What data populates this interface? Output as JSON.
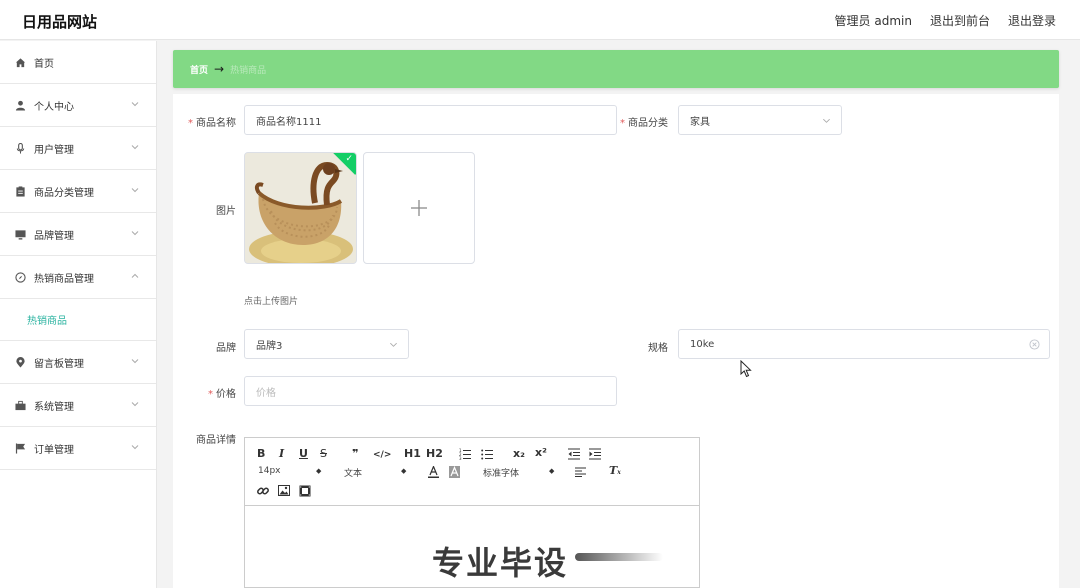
{
  "header": {
    "site_title": "日用品网站",
    "admin_label": "管理员 admin",
    "exit_front_label": "退出到前台",
    "logout_label": "退出登录"
  },
  "sidebar": {
    "items": [
      {
        "label": "首页",
        "icon": "home-icon"
      },
      {
        "label": "个人中心",
        "icon": "user-icon"
      },
      {
        "label": "用户管理",
        "icon": "microphone-icon"
      },
      {
        "label": "商品分类管理",
        "icon": "clipboard-icon"
      },
      {
        "label": "品牌管理",
        "icon": "monitor-icon"
      },
      {
        "label": "热销商品管理",
        "icon": "compass-icon"
      },
      {
        "label": "热销商品",
        "icon": ""
      },
      {
        "label": "留言板管理",
        "icon": "location-pin-icon"
      },
      {
        "label": "系统管理",
        "icon": "suitcase-icon"
      },
      {
        "label": "订单管理",
        "icon": "flag-icon"
      }
    ]
  },
  "breadcrumb": {
    "home": "首页",
    "arrow": "→",
    "current": "热销商品"
  },
  "form": {
    "name_label": "商品名称",
    "name_value": "商品名称1111",
    "category_label": "商品分类",
    "category_value": "家具",
    "image_label": "图片",
    "upload_hint": "点击上传图片",
    "brand_label": "品牌",
    "brand_value": "品牌3",
    "spec_label": "规格",
    "spec_value": "10ke",
    "price_label": "价格",
    "price_placeholder": "价格",
    "detail_label": "商品详情",
    "required_mark": "*"
  },
  "editor": {
    "font_size": "14px",
    "block_format": "文本",
    "font_family": "标准字体",
    "tools": {
      "bold": "B",
      "italic": "I",
      "underline": "U",
      "strike": "S",
      "quote": "❞",
      "code": "</>",
      "h1": "H1",
      "h2": "H2",
      "sub": "x₂",
      "sup": "x²",
      "clear": "T"
    }
  },
  "watermark": "专业毕设",
  "colors": {
    "breadcrumb_bg": "#82d985",
    "active_submenu": "#2ab3a0",
    "required": "#e05a5a",
    "upload_success": "#13ce66"
  }
}
